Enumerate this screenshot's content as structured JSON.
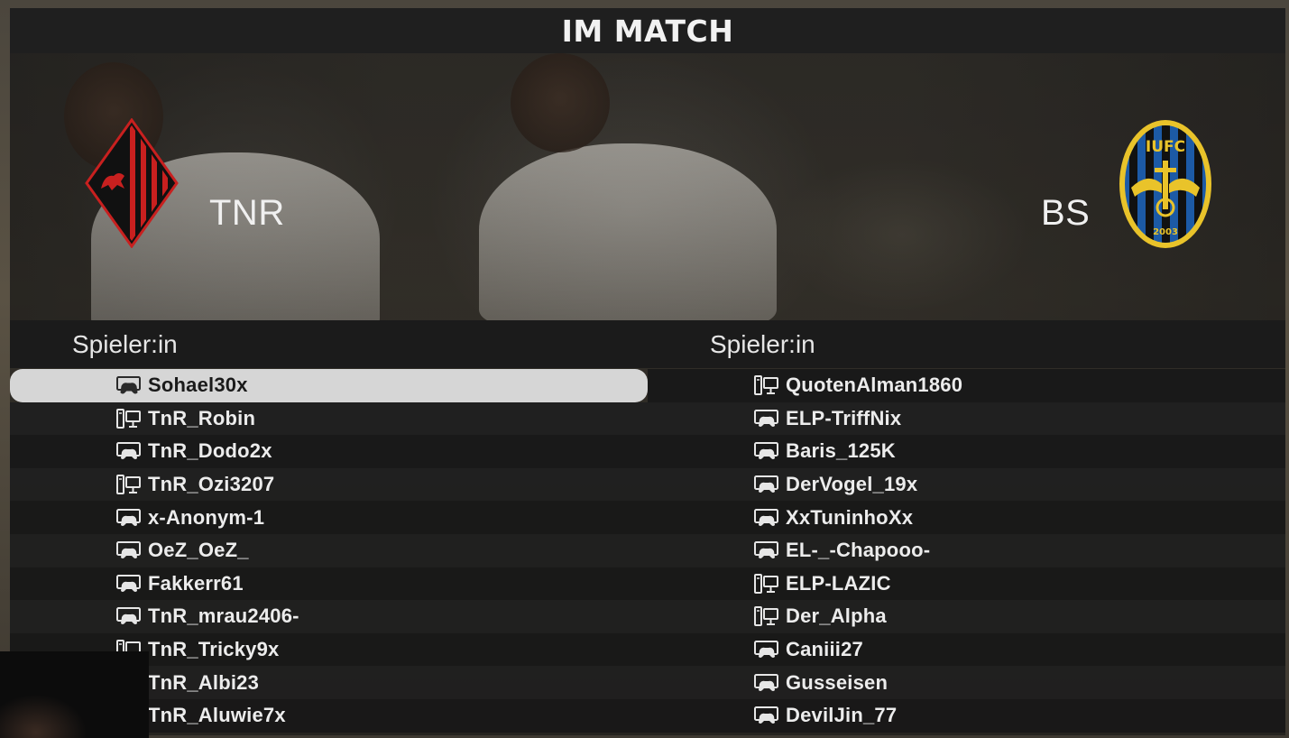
{
  "header": {
    "title": "IM MATCH"
  },
  "teams": {
    "home": {
      "name": "TNR",
      "crest_icon": "tnr-crest-icon",
      "crest_color": "#c8201f"
    },
    "away": {
      "name": "BS",
      "crest_icon": "iufc-crest-icon",
      "crest_text": "IUFC",
      "crest_year": "2003",
      "crest_color": "#e9c32a"
    }
  },
  "columns": {
    "left_header": "Spieler:in",
    "right_header": "Spieler:in"
  },
  "home_players": [
    {
      "name": "Sohael30x",
      "platform": "console-icon",
      "selected": true
    },
    {
      "name": "TnR_Robin",
      "platform": "pc-icon"
    },
    {
      "name": "TnR_Dodo2x",
      "platform": "console-icon"
    },
    {
      "name": "TnR_Ozi3207",
      "platform": "pc-icon"
    },
    {
      "name": "x-Anonym-1",
      "platform": "console-icon"
    },
    {
      "name": "OeZ_OeZ_",
      "platform": "console-icon"
    },
    {
      "name": "Fakkerr61",
      "platform": "console-icon"
    },
    {
      "name": "TnR_mrau2406-",
      "platform": "console-icon"
    },
    {
      "name": "TnR_Tricky9x",
      "platform": "pc-icon"
    },
    {
      "name": "TnR_Albi23",
      "platform": "console-icon"
    },
    {
      "name": "TnR_Aluwie7x",
      "platform": "console-icon"
    }
  ],
  "away_players": [
    {
      "name": "QuotenAlman1860",
      "platform": "pc-icon"
    },
    {
      "name": "ELP-TriffNix",
      "platform": "console-icon"
    },
    {
      "name": "Baris_125K",
      "platform": "console-icon"
    },
    {
      "name": "DerVogel_19x",
      "platform": "console-icon"
    },
    {
      "name": "XxTuninhoXx",
      "platform": "console-icon"
    },
    {
      "name": "EL-_-Chapooo-",
      "platform": "console-icon"
    },
    {
      "name": "ELP-LAZIC",
      "platform": "pc-icon"
    },
    {
      "name": "Der_Alpha",
      "platform": "pc-icon"
    },
    {
      "name": "Caniii27",
      "platform": "console-icon"
    },
    {
      "name": "Gusseisen",
      "platform": "console-icon"
    },
    {
      "name": "DevilJin_77",
      "platform": "console-icon"
    }
  ]
}
